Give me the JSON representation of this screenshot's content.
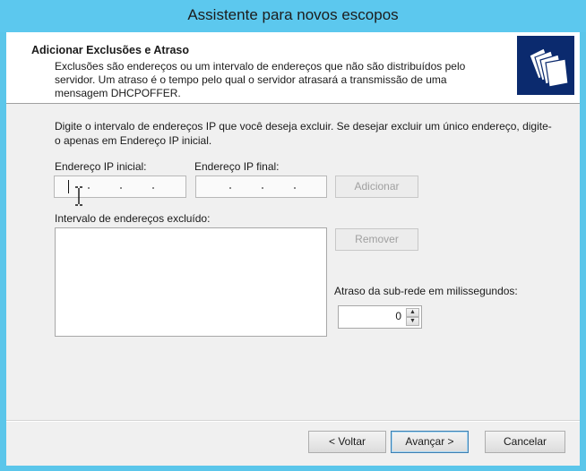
{
  "window": {
    "title": "Assistente para novos escopos"
  },
  "header": {
    "title": "Adicionar Exclusões e Atraso",
    "description": "Exclusões são endereços ou um intervalo de endereços que não são distribuídos pelo servidor. Um atraso é o tempo pelo qual o servidor atrasará a transmissão de uma mensagem DHCPOFFER.",
    "icon": "folders-icon"
  },
  "instructions": "Digite o intervalo de endereços IP que você deseja excluir. Se desejar excluir um único endereço, digite-o apenas em Endereço IP inicial.",
  "start_ip": {
    "label": "Endereço IP inicial:",
    "value": ""
  },
  "end_ip": {
    "label": "Endereço IP final:",
    "value": ""
  },
  "buttons": {
    "add": "Adicionar",
    "remove": "Remover",
    "back": "< Voltar",
    "next": "Avançar >",
    "cancel": "Cancelar"
  },
  "excluded_range": {
    "label": "Intervalo de endereços excluído:",
    "items": []
  },
  "delay": {
    "label": "Atraso da sub-rede em milissegundos:",
    "value": "0"
  }
}
